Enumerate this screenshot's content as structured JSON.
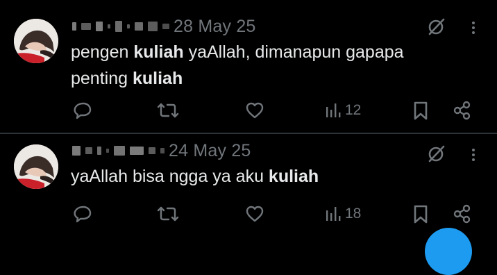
{
  "colors": {
    "background": "#000000",
    "text": "#e7e9ea",
    "muted": "#71767b",
    "divider": "#2f3336",
    "accent": "#1d9bf0"
  },
  "tweets": [
    {
      "date": "28 May 25",
      "text_parts": [
        "pengen ",
        "kuliah",
        " yaAllah, dimanapun gapapa"
      ],
      "text_line2": [
        "penting ",
        "kuliah"
      ],
      "views": "12",
      "icons": [
        "reply-icon",
        "repost-icon",
        "like-icon",
        "views-icon",
        "bookmark-icon",
        "share-icon",
        "grok-icon",
        "more-icon"
      ]
    },
    {
      "date": "24 May 25",
      "text_parts": [
        "yaAllah bisa ngga ya aku ",
        "kuliah"
      ],
      "views": "18",
      "icons": [
        "reply-icon",
        "repost-icon",
        "like-icon",
        "views-icon",
        "bookmark-icon",
        "share-icon",
        "grok-icon",
        "more-icon"
      ]
    }
  ]
}
